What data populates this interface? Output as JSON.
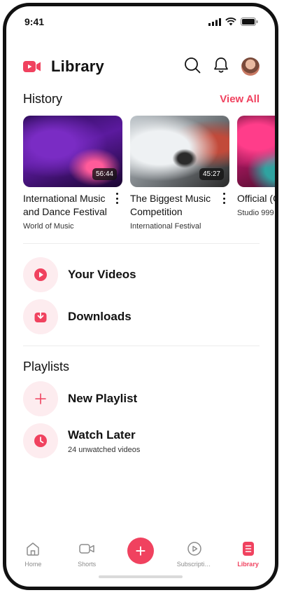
{
  "status_bar": {
    "time": "9:41"
  },
  "header": {
    "title": "Library",
    "avatar_icon": "user-avatar"
  },
  "history": {
    "title": "History",
    "view_all": "View All",
    "items": [
      {
        "title": "International Music and Dance Festival",
        "channel": "World of Music",
        "duration": "56:44"
      },
      {
        "title": "The Biggest Music Competition",
        "channel": "International Festival",
        "duration": "45:27"
      },
      {
        "title": "Official (Only You)",
        "channel": "Studio 999",
        "duration": ""
      }
    ]
  },
  "library_items": [
    {
      "label": "Your Videos",
      "icon": "play-circle-icon"
    },
    {
      "label": "Downloads",
      "icon": "download-icon"
    }
  ],
  "playlists": {
    "title": "Playlists",
    "items": [
      {
        "label": "New Playlist",
        "subtitle": "",
        "icon": "plus-icon"
      },
      {
        "label": "Watch Later",
        "subtitle": "24 unwatched videos",
        "icon": "clock-icon"
      }
    ]
  },
  "bottom_nav": {
    "items": [
      {
        "label": "Home",
        "icon": "home-icon"
      },
      {
        "label": "Shorts",
        "icon": "video-camera-icon"
      },
      {
        "label": "",
        "icon": "add-icon"
      },
      {
        "label": "Subscriptions",
        "icon": "subscriptions-icon"
      },
      {
        "label": "Library",
        "icon": "library-icon",
        "active": true
      }
    ]
  },
  "colors": {
    "accent": "#f0425f",
    "accent_light": "#fdecef",
    "text": "#111111",
    "muted": "#8c8c8c"
  }
}
